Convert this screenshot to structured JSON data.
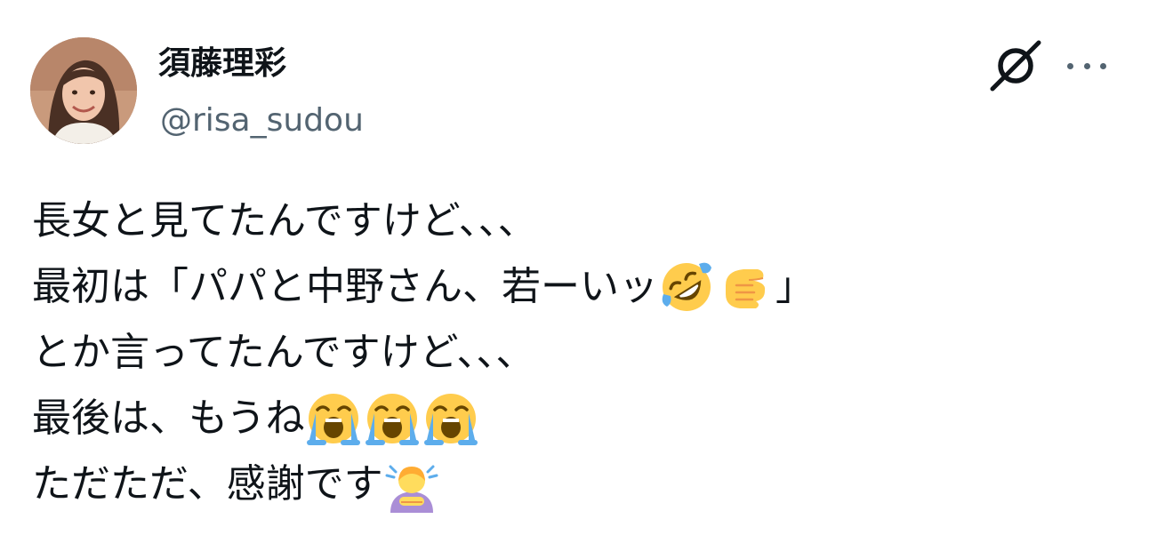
{
  "author": {
    "display_name": "須藤理彩",
    "handle": "@risa_sudou"
  },
  "icons": {
    "brand": "slashed-circle-brand-icon",
    "more": "more-options-icon"
  },
  "colors": {
    "text": "#0f1419",
    "handle": "#536471",
    "emoji_face": "#FFCC4D",
    "emoji_tears": "#5DADEC"
  },
  "tweet": {
    "lines": [
      {
        "text": "長女と見てたんですけど、、、"
      },
      {
        "text": "最初は「パパと中野さん、若ーいッ",
        "suffix": "」",
        "emojis": [
          "rolling-on-floor-laughing-emoji",
          "pointing-hand-emoji"
        ]
      },
      {
        "text": "とか言ってたんですけど、、、"
      },
      {
        "text": "最後は、もうね",
        "emojis": [
          "loudly-crying-face-emoji",
          "loudly-crying-face-emoji",
          "loudly-crying-face-emoji"
        ]
      },
      {
        "text": "ただただ、感謝です",
        "emojis": [
          "person-bowing-emoji"
        ]
      }
    ]
  }
}
